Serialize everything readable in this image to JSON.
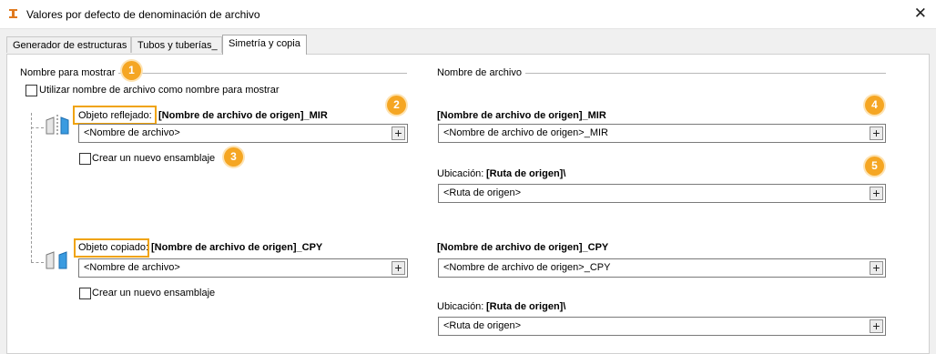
{
  "window": {
    "title": "Valores por defecto de denominación de archivo",
    "close_glyph": "✕"
  },
  "tabs": [
    {
      "label": "Generador de estructuras",
      "active": false
    },
    {
      "label": "Tubos y tuberías_",
      "active": false
    },
    {
      "label": "Simetría y copia",
      "active": true
    }
  ],
  "left": {
    "section_label": "Nombre para mostrar",
    "use_filename_checkbox": {
      "label": "Utilizar nombre de archivo como nombre para mostrar",
      "checked": false
    },
    "mirrored": {
      "label": "Objeto reflejado:",
      "value_text": "[Nombre de archivo de origen]_MIR",
      "field_value": "<Nombre de archivo>",
      "new_assembly": {
        "label": "Crear un nuevo ensamblaje",
        "checked": false
      }
    },
    "copied": {
      "label": "Objeto copiado:",
      "value_text": "[Nombre de archivo de origen]_CPY",
      "field_value": "<Nombre de archivo>",
      "new_assembly": {
        "label": "Crear un nuevo ensamblaje",
        "checked": false
      }
    }
  },
  "right": {
    "section_label": "Nombre de archivo",
    "mirrored": {
      "heading": "[Nombre de archivo de origen]_MIR",
      "field_value": "<Nombre de archivo de origen>_MIR",
      "location_label": "Ubicación:",
      "location_value": "[Ruta de origen]\\",
      "location_field": "<Ruta de origen>"
    },
    "copied": {
      "heading": "[Nombre de archivo de origen]_CPY",
      "field_value": "<Nombre de archivo de origen>_CPY",
      "location_label": "Ubicación:",
      "location_value": "[Ruta de origen]\\",
      "location_field": "<Ruta de origen>"
    }
  },
  "plus_glyph": "+",
  "badges": [
    "1",
    "2",
    "3",
    "4",
    "5"
  ],
  "colors": {
    "highlight": "#f0a30a",
    "badge": "#f5a623",
    "part_icon": "#3a9be0"
  }
}
